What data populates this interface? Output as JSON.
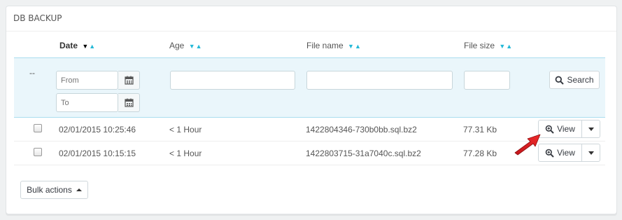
{
  "panel": {
    "title": "DB BACKUP"
  },
  "columns": {
    "date": "Date",
    "age": "Age",
    "file_name": "File name",
    "file_size": "File size"
  },
  "filters": {
    "empty_marker": "--",
    "from_placeholder": "From",
    "to_placeholder": "To",
    "search_label": "Search"
  },
  "rows": [
    {
      "date": "02/01/2015 10:25:46",
      "age": "< 1 Hour",
      "file_name": "1422804346-730b0bb.sql.bz2",
      "file_size": "77.31 Kb",
      "view_label": "View"
    },
    {
      "date": "02/01/2015 10:15:15",
      "age": "< 1 Hour",
      "file_name": "1422803715-31a7040c.sql.bz2",
      "file_size": "77.28 Kb",
      "view_label": "View"
    }
  ],
  "bulk_actions_label": "Bulk actions",
  "colors": {
    "accent": "#25b9d7",
    "filter_bg": "#eaf6fb",
    "arrow": "#e11b22"
  },
  "icons": [
    "calendar-icon",
    "search-icon",
    "zoom-in-icon",
    "caret-down-icon",
    "caret-up-icon",
    "sort-asc-icon",
    "sort-desc-icon",
    "pointer-arrow-icon"
  ]
}
